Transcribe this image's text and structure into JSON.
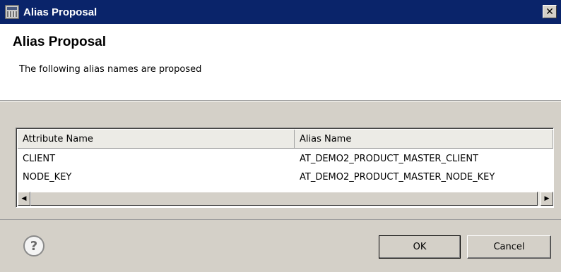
{
  "window": {
    "title": "Alias Proposal",
    "close_label": "✕"
  },
  "header": {
    "heading": "Alias Proposal",
    "subtitle": "The following alias names are proposed"
  },
  "table": {
    "columns": [
      "Attribute Name",
      "Alias Name"
    ],
    "rows": [
      {
        "attribute": "CLIENT",
        "alias": "AT_DEMO2_PRODUCT_MASTER_CLIENT"
      },
      {
        "attribute": "NODE_KEY",
        "alias": "AT_DEMO2_PRODUCT_MASTER_NODE_KEY"
      }
    ],
    "scroll_left": "◀",
    "scroll_right": "▶"
  },
  "footer": {
    "help": "?",
    "ok_label": "OK",
    "cancel_label": "Cancel"
  },
  "icons": {
    "app": "dialog-window-icon",
    "close": "close-icon",
    "help": "help-icon",
    "scroll_left": "arrow-left-icon",
    "scroll_right": "arrow-right-icon"
  }
}
